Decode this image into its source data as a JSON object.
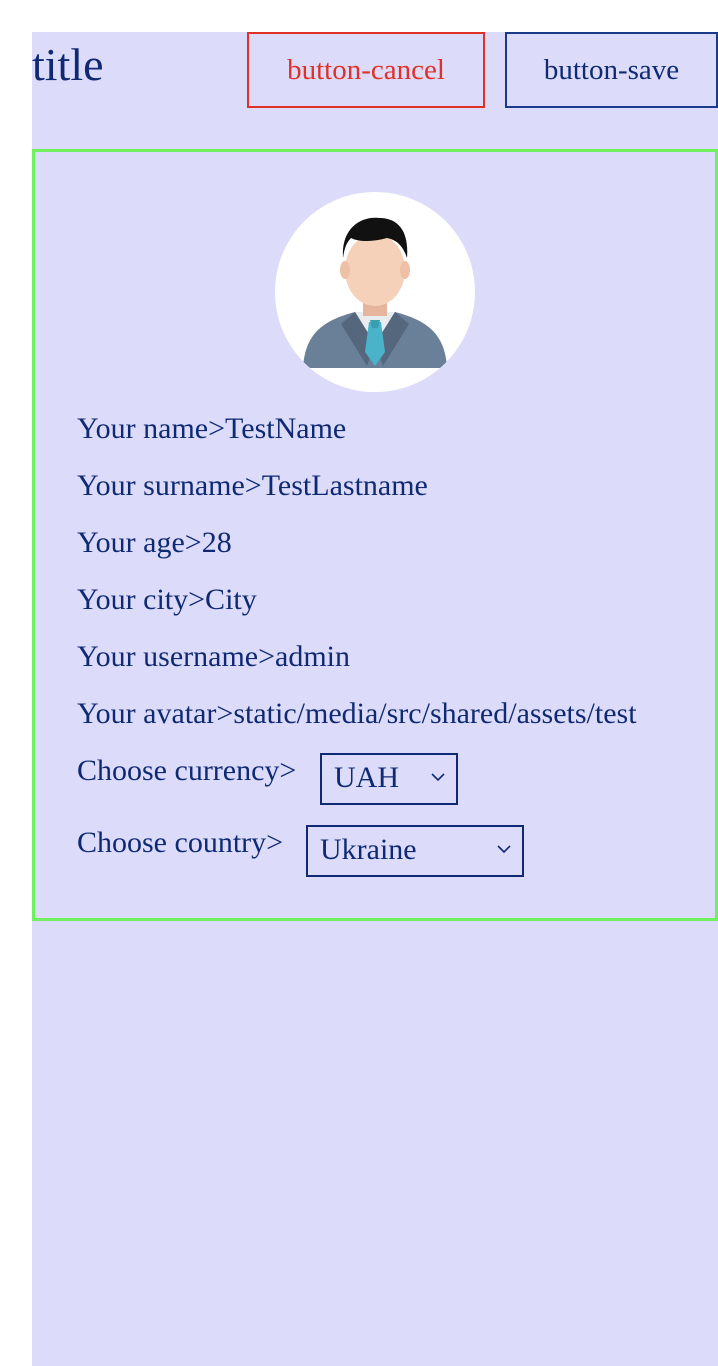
{
  "header": {
    "title": "title",
    "cancel_label": "button-cancel",
    "save_label": "button-save"
  },
  "profile": {
    "avatar_icon": "user-avatar-icon",
    "name": "Your name>TestName",
    "surname": "Your surname>TestLastname",
    "age": "Your age>28",
    "city": "Your city>City",
    "username": "Your username>admin",
    "avatar_path": "Your avatar>static/media/src/shared/assets/test",
    "currency_label": "Choose currency>",
    "currency_value": "UAH",
    "country_label": "Choose country>",
    "country_value": "Ukraine"
  },
  "colors": {
    "background": "#dcdcfa",
    "text": "#0f2a73",
    "cancel": "#e0302a",
    "card_border": "#6ff05e"
  }
}
